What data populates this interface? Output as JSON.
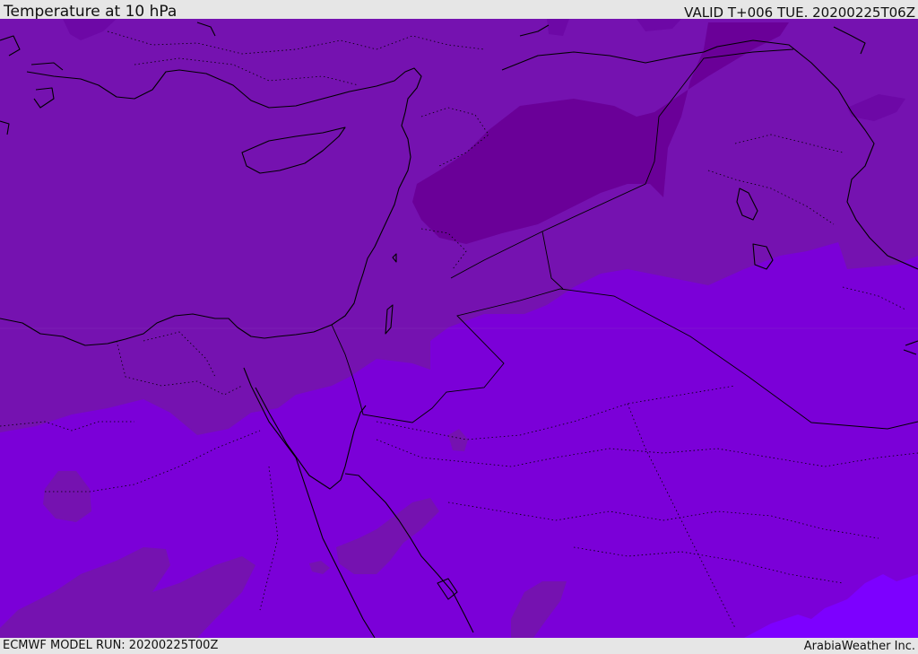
{
  "header": {
    "title": "Temperature at 10 hPa",
    "valid": "VALID T+006 TUE. 20200225T06Z"
  },
  "footer": {
    "model_run": "ECMWF MODEL RUN: 20200225T00Z",
    "credit": "ArabiaWeather Inc."
  },
  "map": {
    "shades": {
      "darkest": "#6a0098",
      "dark": "#7512b0",
      "medium": "#7a14bf",
      "light": "#7b00d8",
      "lightest": "#7d00ff"
    },
    "coastline_color": "#000000"
  }
}
